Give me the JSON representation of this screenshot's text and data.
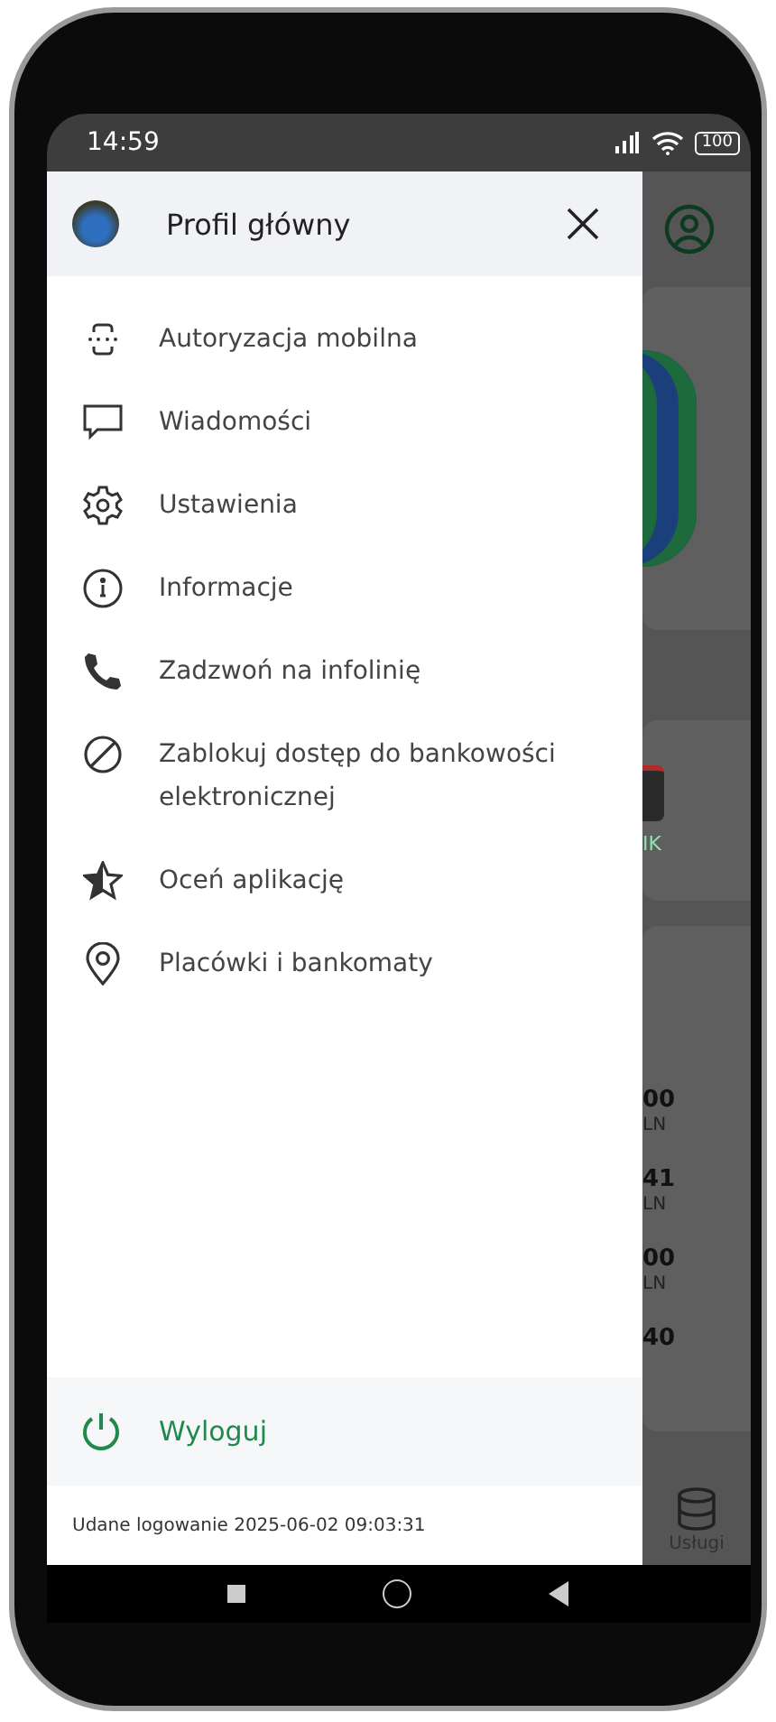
{
  "status_bar": {
    "time": "14:59",
    "battery": "100"
  },
  "drawer": {
    "profile_name": "Profil główny",
    "menu_items": [
      {
        "label": "Autoryzacja mobilna",
        "kind": "auth"
      },
      {
        "label": "Wiadomości",
        "kind": "message"
      },
      {
        "label": "Ustawienia",
        "kind": "settings"
      },
      {
        "label": "Informacje",
        "kind": "info"
      },
      {
        "label": "Zadzwoń na infolinię",
        "kind": "phone"
      },
      {
        "label": "Zablokuj dostęp do bankowości elektronicznej",
        "kind": "block"
      },
      {
        "label": "Oceń aplikację",
        "kind": "star"
      },
      {
        "label": "Placówki i bankomaty",
        "kind": "location"
      }
    ],
    "logout": "Wyloguj",
    "last_login": "Udane logowanie 2025-06-02 09:03:31"
  },
  "background": {
    "tile_label": "IK",
    "amounts": [
      {
        "value": "00",
        "currency": "LN"
      },
      {
        "value": "41",
        "currency": "LN"
      },
      {
        "value": "00",
        "currency": "LN"
      },
      {
        "value": "40"
      }
    ],
    "nav_label": "Usługi"
  }
}
